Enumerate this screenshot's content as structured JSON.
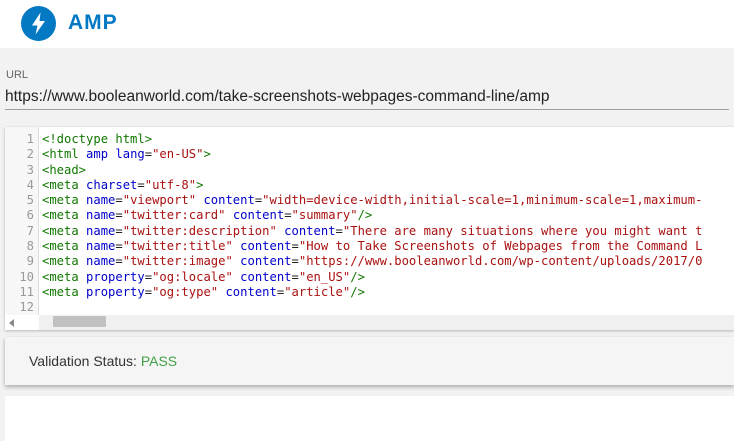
{
  "header": {
    "brand": "AMP",
    "logo_icon": "lightning-bolt-icon",
    "logo_color": "#0379c4"
  },
  "url_field": {
    "label": "URL",
    "value": "https://www.booleanworld.com/take-screenshots-webpages-command-line/amp"
  },
  "code_editor": {
    "lines": [
      {
        "n": "1",
        "tokens": [
          {
            "t": "tag",
            "v": "<!doctype html>"
          }
        ]
      },
      {
        "n": "2",
        "tokens": [
          {
            "t": "tag",
            "v": "<html "
          },
          {
            "t": "attr",
            "v": "amp"
          },
          {
            "t": "tag",
            "v": " "
          },
          {
            "t": "attr",
            "v": "lang"
          },
          {
            "t": "plain",
            "v": "="
          },
          {
            "t": "str",
            "v": "\"en-US\""
          },
          {
            "t": "tag",
            "v": ">"
          }
        ]
      },
      {
        "n": "3",
        "tokens": [
          {
            "t": "tag",
            "v": "<head>"
          }
        ]
      },
      {
        "n": "4",
        "tokens": [
          {
            "t": "tag",
            "v": "<meta "
          },
          {
            "t": "attr",
            "v": "charset"
          },
          {
            "t": "plain",
            "v": "="
          },
          {
            "t": "str",
            "v": "\"utf-8\""
          },
          {
            "t": "tag",
            "v": ">"
          }
        ]
      },
      {
        "n": "5",
        "tokens": [
          {
            "t": "tag",
            "v": "<meta "
          },
          {
            "t": "attr",
            "v": "name"
          },
          {
            "t": "plain",
            "v": "="
          },
          {
            "t": "str",
            "v": "\"viewport\""
          },
          {
            "t": "tag",
            "v": " "
          },
          {
            "t": "attr",
            "v": "content"
          },
          {
            "t": "plain",
            "v": "="
          },
          {
            "t": "str",
            "v": "\"width=device-width,initial-scale=1,minimum-scale=1,maximum-"
          }
        ]
      },
      {
        "n": "6",
        "tokens": [
          {
            "t": "tag",
            "v": "<meta "
          },
          {
            "t": "attr",
            "v": "name"
          },
          {
            "t": "plain",
            "v": "="
          },
          {
            "t": "str",
            "v": "\"twitter:card\""
          },
          {
            "t": "tag",
            "v": " "
          },
          {
            "t": "attr",
            "v": "content"
          },
          {
            "t": "plain",
            "v": "="
          },
          {
            "t": "str",
            "v": "\"summary\""
          },
          {
            "t": "tag",
            "v": "/>"
          }
        ]
      },
      {
        "n": "7",
        "tokens": [
          {
            "t": "tag",
            "v": "<meta "
          },
          {
            "t": "attr",
            "v": "name"
          },
          {
            "t": "plain",
            "v": "="
          },
          {
            "t": "str",
            "v": "\"twitter:description\""
          },
          {
            "t": "tag",
            "v": " "
          },
          {
            "t": "attr",
            "v": "content"
          },
          {
            "t": "plain",
            "v": "="
          },
          {
            "t": "str",
            "v": "\"There are many situations where you might want t"
          }
        ]
      },
      {
        "n": "8",
        "tokens": [
          {
            "t": "tag",
            "v": "<meta "
          },
          {
            "t": "attr",
            "v": "name"
          },
          {
            "t": "plain",
            "v": "="
          },
          {
            "t": "str",
            "v": "\"twitter:title\""
          },
          {
            "t": "tag",
            "v": " "
          },
          {
            "t": "attr",
            "v": "content"
          },
          {
            "t": "plain",
            "v": "="
          },
          {
            "t": "str",
            "v": "\"How to Take Screenshots of Webpages from the Command L"
          }
        ]
      },
      {
        "n": "9",
        "tokens": [
          {
            "t": "tag",
            "v": "<meta "
          },
          {
            "t": "attr",
            "v": "name"
          },
          {
            "t": "plain",
            "v": "="
          },
          {
            "t": "str",
            "v": "\"twitter:image\""
          },
          {
            "t": "tag",
            "v": " "
          },
          {
            "t": "attr",
            "v": "content"
          },
          {
            "t": "plain",
            "v": "="
          },
          {
            "t": "str",
            "v": "\"https://www.booleanworld.com/wp-content/uploads/2017/0"
          }
        ]
      },
      {
        "n": "10",
        "tokens": [
          {
            "t": "tag",
            "v": "<meta "
          },
          {
            "t": "attr",
            "v": "property"
          },
          {
            "t": "plain",
            "v": "="
          },
          {
            "t": "str",
            "v": "\"og:locale\""
          },
          {
            "t": "tag",
            "v": " "
          },
          {
            "t": "attr",
            "v": "content"
          },
          {
            "t": "plain",
            "v": "="
          },
          {
            "t": "str",
            "v": "\"en_US\""
          },
          {
            "t": "tag",
            "v": "/>"
          }
        ]
      },
      {
        "n": "11",
        "tokens": [
          {
            "t": "tag",
            "v": "<meta "
          },
          {
            "t": "attr",
            "v": "property"
          },
          {
            "t": "plain",
            "v": "="
          },
          {
            "t": "str",
            "v": "\"og:type\""
          },
          {
            "t": "tag",
            "v": " "
          },
          {
            "t": "attr",
            "v": "content"
          },
          {
            "t": "plain",
            "v": "="
          },
          {
            "t": "str",
            "v": "\"article\""
          },
          {
            "t": "tag",
            "v": "/>"
          }
        ]
      },
      {
        "n": "12",
        "tokens": []
      }
    ]
  },
  "validation": {
    "label": "Validation Status: ",
    "status": "PASS",
    "status_color": "#43a047"
  }
}
